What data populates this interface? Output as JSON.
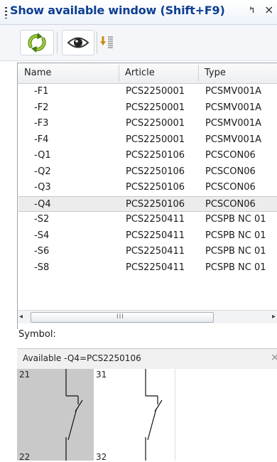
{
  "window": {
    "title": "Show available window (Shift+F9)",
    "pin_glyph": "ߤ",
    "close_glyph": "×"
  },
  "toolbar": {
    "refresh_icon": "refresh-icon",
    "view_icon": "eye-icon",
    "transfer_icon": "arrow-list-icon"
  },
  "table": {
    "columns": [
      "Name",
      "Article",
      "Type"
    ],
    "rows": [
      {
        "name": "-F1",
        "article": "PCS2250001",
        "type": "PCSMV001A"
      },
      {
        "name": "-F2",
        "article": "PCS2250001",
        "type": "PCSMV001A"
      },
      {
        "name": "-F3",
        "article": "PCS2250001",
        "type": "PCSMV001A"
      },
      {
        "name": "-F4",
        "article": "PCS2250001",
        "type": "PCSMV001A"
      },
      {
        "name": "-Q1",
        "article": "PCS2250106",
        "type": "PCSCON06"
      },
      {
        "name": "-Q2",
        "article": "PCS2250106",
        "type": "PCSCON06"
      },
      {
        "name": "-Q3",
        "article": "PCS2250106",
        "type": "PCSCON06"
      },
      {
        "name": "-Q4",
        "article": "PCS2250106",
        "type": "PCSCON06",
        "selected": true
      },
      {
        "name": "-S2",
        "article": "PCS2250411",
        "type": "PCSPB NC 01"
      },
      {
        "name": "-S4",
        "article": "PCS2250411",
        "type": "PCSPB NC 01"
      },
      {
        "name": "-S6",
        "article": "PCS2250411",
        "type": "PCSPB NC 01"
      },
      {
        "name": "-S8",
        "article": "PCS2250411",
        "type": "PCSPB NC 01"
      }
    ]
  },
  "scrollbar": {
    "left_arrow": "◂",
    "right_arrow": "▸",
    "grip": "III"
  },
  "symbol": {
    "label": "Symbol:",
    "available_text": "Available -Q4=PCS2250106",
    "close_glyph": "×",
    "pins": [
      {
        "top": "21",
        "bottom": "22"
      },
      {
        "top": "31",
        "bottom": "32"
      }
    ]
  }
}
